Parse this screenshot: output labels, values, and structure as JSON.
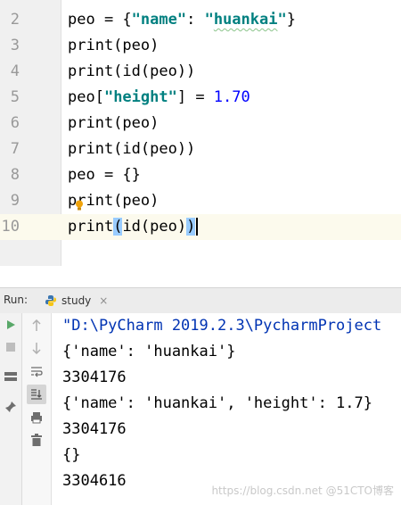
{
  "editor": {
    "lines": [
      {
        "num": "2",
        "tokens": [
          {
            "t": "peo = {"
          },
          {
            "t": "\"name\"",
            "c": "kw-str"
          },
          {
            "t": ": "
          },
          {
            "t": "\"",
            "c": "kw-str"
          },
          {
            "t": "huankai",
            "c": "kw-str squiggle"
          },
          {
            "t": "\"",
            "c": "kw-str"
          },
          {
            "t": "}"
          }
        ]
      },
      {
        "num": "3",
        "tokens": [
          {
            "t": "print(peo)"
          }
        ]
      },
      {
        "num": "4",
        "tokens": [
          {
            "t": "print(id(peo))"
          }
        ]
      },
      {
        "num": "5",
        "tokens": [
          {
            "t": "peo["
          },
          {
            "t": "\"height\"",
            "c": "kw-str"
          },
          {
            "t": "] = "
          },
          {
            "t": "1.70",
            "c": "num"
          }
        ]
      },
      {
        "num": "6",
        "tokens": [
          {
            "t": "print(peo)"
          }
        ]
      },
      {
        "num": "7",
        "tokens": [
          {
            "t": "print(id(peo))"
          }
        ]
      },
      {
        "num": "8",
        "tokens": [
          {
            "t": "peo = {}"
          }
        ]
      },
      {
        "num": "9",
        "tokens": [
          {
            "t": "print(peo)"
          }
        ]
      },
      {
        "num": "10",
        "current": true,
        "tokens": [
          {
            "t": "print"
          },
          {
            "t": "(",
            "c": "paren-hl"
          },
          {
            "t": "id(peo)"
          },
          {
            "t": ")",
            "c": "paren-hl"
          },
          {
            "caret": true
          }
        ]
      }
    ]
  },
  "run_bar": {
    "label": "Run:",
    "tab_label": "study",
    "close_glyph": "×"
  },
  "console": {
    "lines": [
      {
        "text": "\"D:\\PyCharm 2019.2.3\\PycharmProject",
        "kind": "cmd"
      },
      {
        "text": "{'name': 'huankai'}"
      },
      {
        "text": "3304176"
      },
      {
        "text": "{'name': 'huankai', 'height': 1.7}"
      },
      {
        "text": "3304176"
      },
      {
        "text": "{}"
      },
      {
        "text": "3304616"
      }
    ]
  },
  "watermark": "https://blog.csdn.net @51CTO博客",
  "icons": {
    "run": "run-icon",
    "stop": "stop-icon",
    "layout": "layout-icon",
    "pin": "pin-icon",
    "up": "arrow-up-icon",
    "down": "arrow-down-icon",
    "wrap": "soft-wrap-icon",
    "scroll": "scroll-to-end-icon",
    "print": "print-icon",
    "trash": "trash-icon",
    "python": "python-icon",
    "bulb": "lightbulb-icon"
  },
  "colors": {
    "string": "#008080",
    "number": "#0000ff",
    "paren_highlight": "#99ccff",
    "current_line": "#fcfaed",
    "run_green": "#59a869"
  }
}
